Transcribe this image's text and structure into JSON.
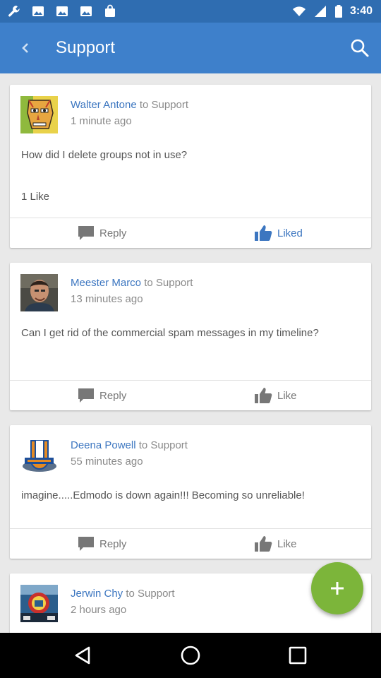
{
  "status_bar": {
    "time": "3:40"
  },
  "app_bar": {
    "title": "Support"
  },
  "posts": [
    {
      "author": "Walter Antone",
      "target": " to Support",
      "time": "1 minute ago",
      "body": "How did I delete groups not in use?",
      "likes": "1 Like",
      "reply_label": "Reply",
      "like_label": "Liked",
      "liked": true
    },
    {
      "author": "Meester Marco",
      "target": " to Support",
      "time": "13 minutes ago",
      "body": "Can I get rid of the commercial spam messages in my timeline?",
      "reply_label": "Reply",
      "like_label": "Like",
      "liked": false
    },
    {
      "author": "Deena Powell",
      "target": " to Support",
      "time": "55 minutes ago",
      "body": "imagine.....Edmodo is down again!!! Becoming so unreliable!",
      "reply_label": "Reply",
      "like_label": "Like",
      "liked": false
    },
    {
      "author": "Jerwin Chy",
      "target": " to Support",
      "time": "2 hours ago"
    }
  ],
  "icons": {
    "back": "back-arrow-icon",
    "search": "search-icon",
    "reply": "comment-icon",
    "like": "thumbs-up-icon",
    "add": "plus-icon"
  },
  "colors": {
    "status_bar": "#2f6db1",
    "app_bar": "#3e80cb",
    "accent": "#3c76c0",
    "fab": "#7cb53a",
    "background": "#e9e9e9"
  }
}
